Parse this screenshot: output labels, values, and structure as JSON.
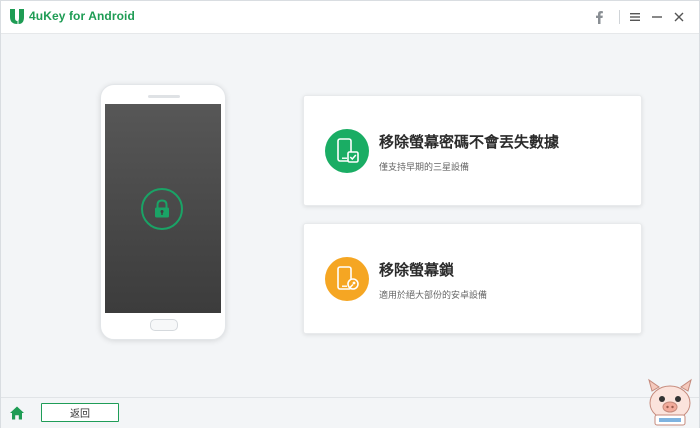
{
  "app": {
    "title": "4uKey for Android",
    "brand_color": "#1e9c54"
  },
  "titlebar": {
    "icons": [
      "facebook-icon",
      "menu-icon",
      "minimize-icon",
      "close-icon"
    ]
  },
  "cards": [
    {
      "title": "移除螢幕密碼不會丟失數據",
      "description": "僅支持早期的三星設備",
      "icon": "phone-check-icon",
      "icon_color": "#1aad64"
    },
    {
      "title": "移除螢幕鎖",
      "description": "適用於絕大部份的安卓設備",
      "icon": "phone-key-icon",
      "icon_color": "#f5a623"
    }
  ],
  "footer": {
    "back_label": "返回",
    "home_icon": "home-icon"
  }
}
